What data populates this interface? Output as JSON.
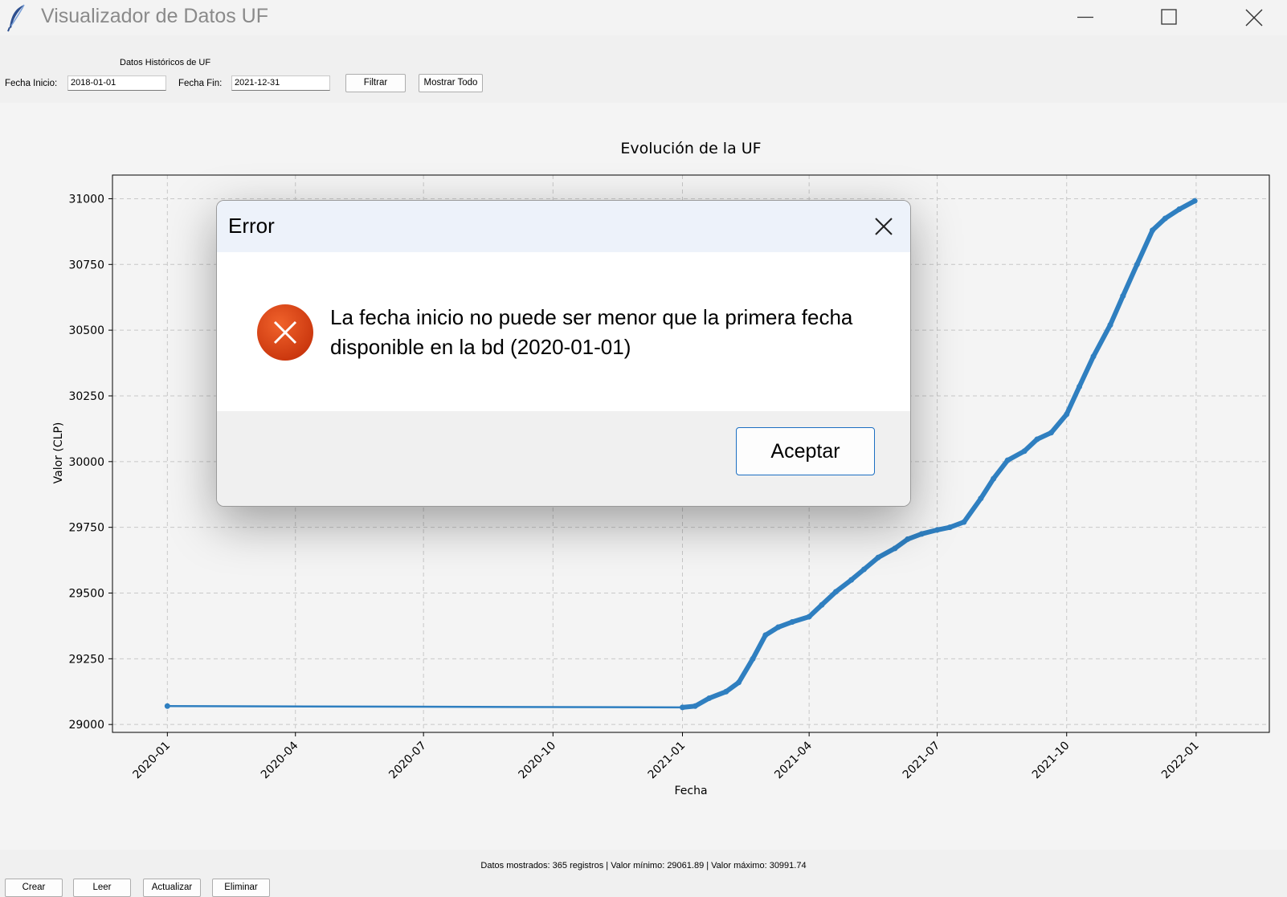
{
  "window": {
    "title": "Visualizador de Datos UF",
    "icons": [
      "feather-icon",
      "minimize-icon",
      "maximize-icon",
      "close-icon"
    ]
  },
  "toolbar": {
    "heading": "Datos Históricos de UF",
    "start_label": "Fecha Inicio:",
    "start_value": "2018-01-01",
    "end_label": "Fecha Fin:",
    "end_value": "2021-12-31",
    "filter_label": "Filtrar",
    "show_all_label": "Mostrar Todo"
  },
  "chart_data": {
    "type": "line",
    "title": "Evolución de la UF",
    "xlabel": "Fecha",
    "ylabel": "Valor (CLP)",
    "x_ticks": [
      "2020-01",
      "2020-04",
      "2020-07",
      "2020-10",
      "2021-01",
      "2021-04",
      "2021-07",
      "2021-10",
      "2022-01"
    ],
    "y_ticks": [
      29000,
      29250,
      29500,
      29750,
      30000,
      30250,
      30500,
      30750,
      31000
    ],
    "ylim": [
      28970,
      31090
    ],
    "xlim": [
      "2019-11-23",
      "2022-02-22"
    ],
    "grid": true,
    "color": "#2f7fc0",
    "series": [
      {
        "x": [
          "2020-01-01",
          "2021-01-01",
          "2021-01-10",
          "2021-01-20",
          "2021-02-01",
          "2021-02-10",
          "2021-02-20",
          "2021-03-01",
          "2021-03-10",
          "2021-03-20",
          "2021-04-01",
          "2021-04-10",
          "2021-04-20",
          "2021-05-01",
          "2021-05-10",
          "2021-05-20",
          "2021-06-01",
          "2021-06-10",
          "2021-06-20",
          "2021-07-01",
          "2021-07-10",
          "2021-07-20",
          "2021-08-01",
          "2021-08-10",
          "2021-08-20",
          "2021-09-01",
          "2021-09-10",
          "2021-09-20",
          "2021-10-01",
          "2021-10-10",
          "2021-10-20",
          "2021-11-01",
          "2021-11-10",
          "2021-11-20",
          "2021-12-01",
          "2021-12-10",
          "2021-12-20",
          "2021-12-31"
        ],
        "y": [
          29070,
          29065,
          29070,
          29100,
          29125,
          29160,
          29250,
          29340,
          29370,
          29390,
          29410,
          29455,
          29505,
          29550,
          29590,
          29635,
          29670,
          29705,
          29725,
          29740,
          29750,
          29770,
          29860,
          29935,
          30005,
          30040,
          30085,
          30110,
          30180,
          30285,
          30400,
          30520,
          30630,
          30750,
          30880,
          30925,
          30960,
          30991.74
        ]
      }
    ]
  },
  "dialog": {
    "title": "Error",
    "message_line1": "La fecha inicio no puede ser menor que la primera fecha",
    "message_line2": "disponible en la bd (2020-01-01)",
    "ok_label": "Aceptar"
  },
  "status": "Datos mostrados: 365 registros | Valor mínimo: 29061.89 | Valor máximo: 30991.74",
  "crud_buttons": [
    "Crear",
    "Leer",
    "Actualizar",
    "Eliminar"
  ]
}
